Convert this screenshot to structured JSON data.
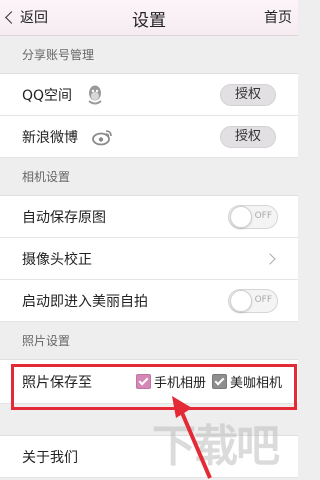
{
  "nav": {
    "back_label": "返回",
    "title": "设置",
    "home_label": "首页"
  },
  "sections": {
    "share": "分享账号管理",
    "camera": "相机设置",
    "photo": "照片设置"
  },
  "share_rows": [
    {
      "label": "QQ空间",
      "icon": "qq-penguin-icon",
      "button": "授权"
    },
    {
      "label": "新浪微博",
      "icon": "weibo-icon",
      "button": "授权"
    }
  ],
  "camera_rows": {
    "autosave": {
      "label": "自动保存原图",
      "toggle": "OFF"
    },
    "calibrate": {
      "label": "摄像头校正"
    },
    "selfie": {
      "label": "启动即进入美丽自拍",
      "toggle": "OFF"
    }
  },
  "photo_save": {
    "label": "照片保存至",
    "options": [
      {
        "label": "手机相册",
        "checked": true,
        "color": "#d587b6"
      },
      {
        "label": "美咖相机",
        "checked": true,
        "color": "#8e8e8e"
      }
    ]
  },
  "about": {
    "label": "关于我们"
  },
  "watermark": "下载吧",
  "colors": {
    "highlight": "#e32a36",
    "arrow": "#e32a36"
  }
}
